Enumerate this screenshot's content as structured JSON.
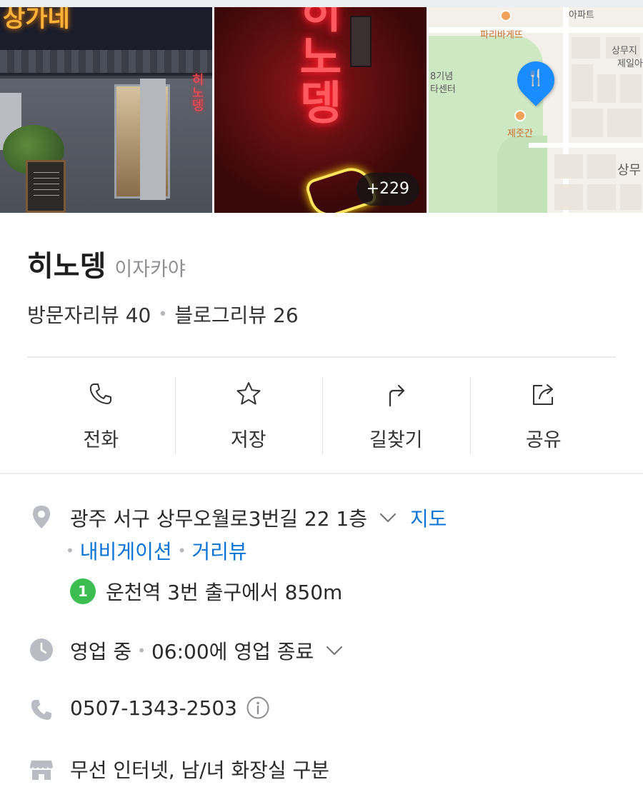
{
  "photos": {
    "storefront_sign": "상가네",
    "neon_vertical": "히노뎅",
    "more_count": "+229"
  },
  "map": {
    "labels": {
      "apartment": "아파트",
      "paris": "파리바게뜨",
      "sangmuji": "상무지",
      "jeil": "제일아",
      "memorial": "8기념",
      "center": "타센터",
      "jejugan": "제줏간",
      "sangmu": "상무"
    }
  },
  "place": {
    "name": "히노뎅",
    "category": "이자카야",
    "visitor_reviews": "방문자리뷰 40",
    "blog_reviews": "블로그리뷰 26"
  },
  "actions": [
    {
      "label": "전화",
      "icon": "phone-icon"
    },
    {
      "label": "저장",
      "icon": "star-icon"
    },
    {
      "label": "길찾기",
      "icon": "directions-icon"
    },
    {
      "label": "공유",
      "icon": "share-icon"
    }
  ],
  "info": {
    "address": "광주 서구 상무오월로3번길 22 1층",
    "map_link": "지도",
    "navigation_link": "내비게이션",
    "streetview_link": "거리뷰",
    "subway_line": "1",
    "subway_text": "운천역 3번 출구에서 850m",
    "hours_status": "영업 중",
    "hours_detail": "06:00에 영업 종료",
    "phone": "0507-1343-2503",
    "amenities": "무선 인터넷, 남/녀 화장실 구분"
  },
  "colors": {
    "link": "#0a74d6",
    "subway_line_1": "#3cbd50",
    "map_pin": "#1a8cff"
  }
}
